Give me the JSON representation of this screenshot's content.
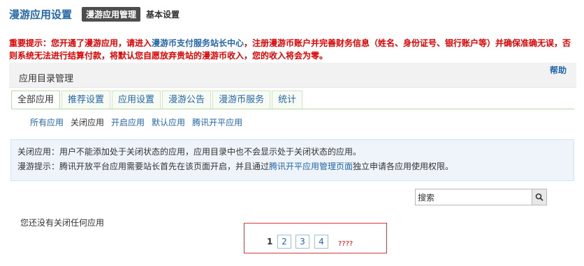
{
  "header": {
    "title": "漫游应用设置",
    "tab_active": "漫游应用管理",
    "tab_basic": "基本设置"
  },
  "notice": {
    "prefix": "重要提示：您开通了漫游应用，请进入",
    "link": "漫游币支付服务站长中心",
    "suffix": "，注册漫游币账户并完善财务信息（姓名、身份证号、银行账户等）并确保准确无误，否则系统无法进行结算付款，将默认您自愿放弃贵站的漫游币收入，您的收入将会为零。"
  },
  "panel": {
    "title": "应用目录管理",
    "help": "帮助"
  },
  "tabs": [
    "全部应用",
    "推荐设置",
    "应用设置",
    "漫游公告",
    "漫游币服务",
    "统计"
  ],
  "subnav": [
    "所有应用",
    "关闭应用",
    "开启应用",
    "默认应用",
    "腾讯开平应用"
  ],
  "info": {
    "line1": "关闭应用：用户不能添加处于关闭状态的应用，应用目录中也不会显示处于关闭状态的应用。",
    "line2_prefix": "漫游提示：腾讯开放平台应用需要站长首先在该页面开启，并且通过",
    "line2_link": "腾讯开平应用管理页面",
    "line2_suffix": "独立申请各应用使用权限。"
  },
  "search": {
    "value": "搜索",
    "icon": "search-icon"
  },
  "empty_message": "您还没有关闭任何应用",
  "pagination": {
    "current": "1",
    "pages": [
      "2",
      "3",
      "4"
    ],
    "extra": "????"
  },
  "colors": {
    "link": "#2366A8",
    "warning": "#e00000",
    "tab_active_bg": "#4d4d4d",
    "info_bg": "#eef4fa",
    "pager_border": "#d43a3a"
  }
}
